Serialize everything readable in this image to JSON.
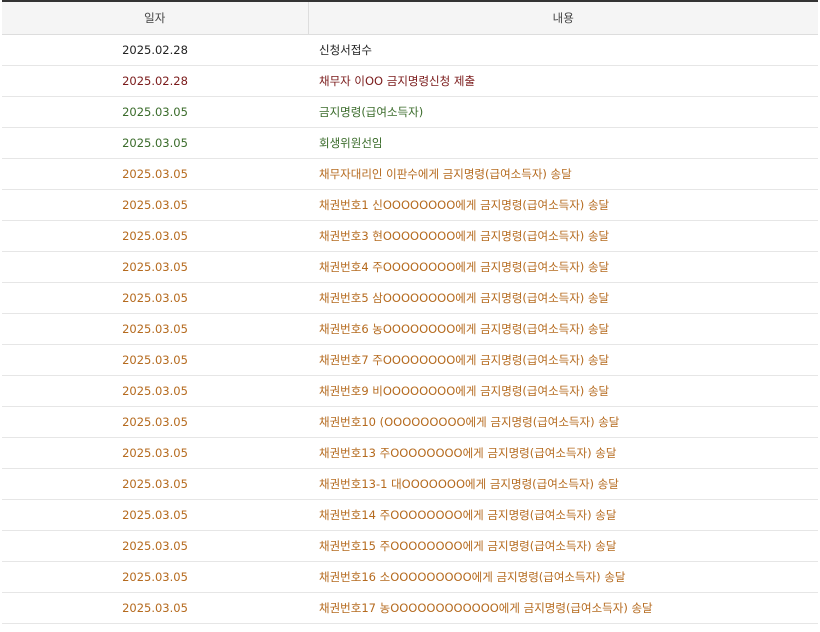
{
  "colors": {
    "black": "#222222",
    "maroon": "#7a1a1a",
    "green": "#3a6b2a",
    "orange": "#b56a1e"
  },
  "table": {
    "headers": {
      "date": "일자",
      "content": "내용"
    },
    "rows": [
      {
        "date": "2025.02.28",
        "content": "신청서접수",
        "tone": "black"
      },
      {
        "date": "2025.02.28",
        "content": "채무자 이OO 금지명령신청 제출",
        "tone": "maroon"
      },
      {
        "date": "2025.03.05",
        "content": "금지명령(급여소득자)",
        "tone": "green"
      },
      {
        "date": "2025.03.05",
        "content": "회생위원선임",
        "tone": "green"
      },
      {
        "date": "2025.03.05",
        "content": "채무자대리인 이판수에게 금지명령(급여소득자) 송달",
        "tone": "orange"
      },
      {
        "date": "2025.03.05",
        "content": "채권번호1 신OOOOOOOO에게 금지명령(급여소득자) 송달",
        "tone": "orange"
      },
      {
        "date": "2025.03.05",
        "content": "채권번호3 현OOOOOOOO에게 금지명령(급여소득자) 송달",
        "tone": "orange"
      },
      {
        "date": "2025.03.05",
        "content": "채권번호4 주OOOOOOOO에게 금지명령(급여소득자) 송달",
        "tone": "orange"
      },
      {
        "date": "2025.03.05",
        "content": "채권번호5 삼OOOOOOOO에게 금지명령(급여소득자) 송달",
        "tone": "orange"
      },
      {
        "date": "2025.03.05",
        "content": "채권번호6 농OOOOOOOO에게 금지명령(급여소득자) 송달",
        "tone": "orange"
      },
      {
        "date": "2025.03.05",
        "content": "채권번호7 주OOOOOOOO에게 금지명령(급여소득자) 송달",
        "tone": "orange"
      },
      {
        "date": "2025.03.05",
        "content": "채권번호9 비OOOOOOOO에게 금지명령(급여소득자) 송달",
        "tone": "orange"
      },
      {
        "date": "2025.03.05",
        "content": "채권번호10 (OOOOOOOOO에게 금지명령(급여소득자) 송달",
        "tone": "orange"
      },
      {
        "date": "2025.03.05",
        "content": "채권번호13 주OOOOOOOO에게 금지명령(급여소득자) 송달",
        "tone": "orange"
      },
      {
        "date": "2025.03.05",
        "content": "채권번호13-1 대OOOOOOO에게 금지명령(급여소득자) 송달",
        "tone": "orange"
      },
      {
        "date": "2025.03.05",
        "content": "채권번호14 주OOOOOOOO에게 금지명령(급여소득자) 송달",
        "tone": "orange"
      },
      {
        "date": "2025.03.05",
        "content": "채권번호15 주OOOOOOOO에게 금지명령(급여소득자) 송달",
        "tone": "orange"
      },
      {
        "date": "2025.03.05",
        "content": "채권번호16 소OOOOOOOOO에게 금지명령(급여소득자) 송달",
        "tone": "orange"
      },
      {
        "date": "2025.03.05",
        "content": "채권번호17 농OOOOOOOOOOOO에게 금지명령(급여소득자) 송달",
        "tone": "orange"
      }
    ]
  }
}
